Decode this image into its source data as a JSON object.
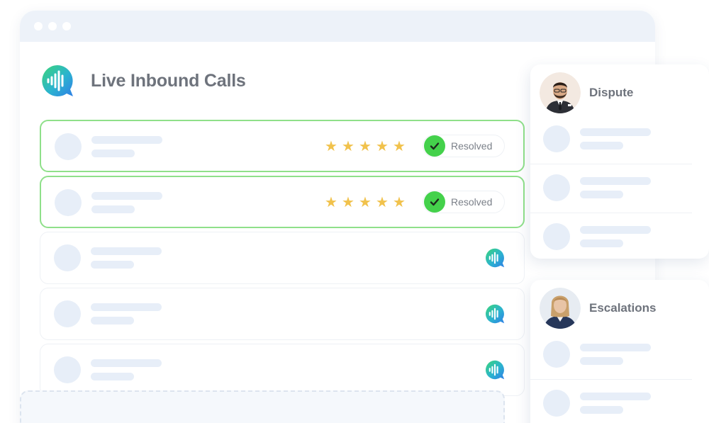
{
  "app": {
    "title": "Live Inbound Calls",
    "logo_icon": "soundwave-chat-logo-icon",
    "accent_gradient": [
      "#36d27e",
      "#2f8fe6"
    ]
  },
  "calls": [
    {
      "state": "resolved",
      "rating": 5,
      "status_label": "Resolved"
    },
    {
      "state": "resolved",
      "rating": 5,
      "status_label": "Resolved"
    },
    {
      "state": "live",
      "icon": "soundwave-icon"
    },
    {
      "state": "live",
      "icon": "soundwave-icon"
    },
    {
      "state": "live",
      "icon": "soundwave-icon"
    }
  ],
  "queues": [
    {
      "title": "Dispute",
      "avatar": "agent-avatar-male"
    },
    {
      "title": "Escalations",
      "avatar": "agent-avatar-female"
    }
  ],
  "colors": {
    "resolved_border": "#8fe08a",
    "check_green": "#44d14b",
    "star": "#f1c24c",
    "skeleton": "#e7eef8",
    "wave": "#5fcdd8"
  }
}
